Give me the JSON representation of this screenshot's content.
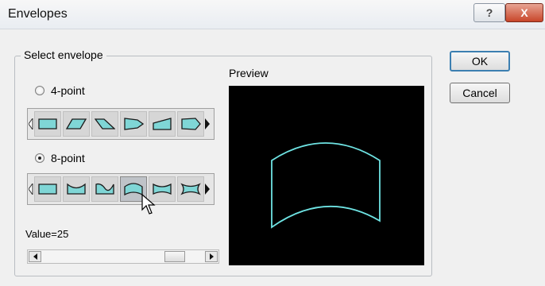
{
  "window": {
    "title": "Envelopes",
    "help_glyph": "?",
    "close_glyph": "X"
  },
  "group": {
    "legend": "Select envelope"
  },
  "options": {
    "four_point": {
      "label": "4-point",
      "selected": false
    },
    "eight_point": {
      "label": "8-point",
      "selected": true
    }
  },
  "four_point_shapes": [
    "rectangle-icon",
    "parallelogram-icon",
    "trapezoid-left-icon",
    "arrow-pentagon-icon",
    "trapezoid-right-icon",
    "tapered-pentagon-icon"
  ],
  "eight_point_shapes": [
    "rectangle-icon",
    "concave-top-icon",
    "wave-top-icon",
    "arch-top-icon",
    "concave-top-bottom-icon",
    "bowtie-icon"
  ],
  "eight_point_selected_index": 3,
  "preview": {
    "label": "Preview",
    "bg_color": "#000000",
    "curve_color": "#6ee3e3"
  },
  "value": {
    "text": "Value=25",
    "level": 0.25
  },
  "buttons": {
    "ok": "OK",
    "cancel": "Cancel"
  },
  "colors": {
    "shape_fill": "#7fd6d6",
    "shape_stroke": "#1a1a1a"
  }
}
